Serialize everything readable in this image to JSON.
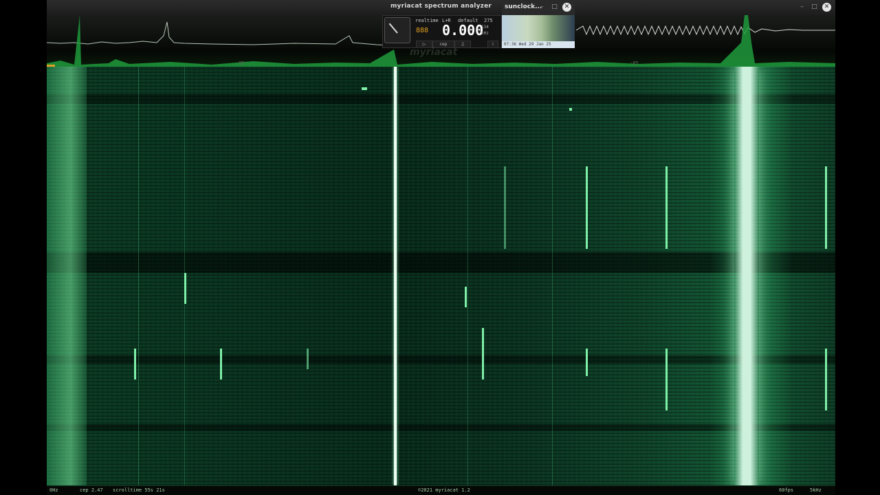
{
  "window": {
    "title": "myriacat spectrum analyzer",
    "controls": {
      "minimize": "–",
      "maximize": "□",
      "close": "✕"
    }
  },
  "spectrum": {
    "db_left": "-85",
    "db_right": "-85"
  },
  "meter": {
    "mode": "realtime",
    "channel": "L+R",
    "profile": "default",
    "value_top": "275",
    "value": "0.000",
    "unit_top": "134",
    "unit": "kHz",
    "digits": "888",
    "btn_ctrl": "▷",
    "btn_mode": "cep",
    "btn_music": "♫",
    "btn_info": "i",
    "brand": "myriacat"
  },
  "sunclock": {
    "title": "sunclock...",
    "time": "07:36 Wed 29 Jan 25",
    "controls": {
      "minimize": "–",
      "maximize": "□",
      "close": "✕"
    }
  },
  "statusbar": {
    "freq_start": "0Hz",
    "cep": "cep 2.47",
    "scrolltime": "scrolltime 55s 21s",
    "copyright": "©2021 myriacat 1.2",
    "fps": "60fps",
    "freq_end": "5kHz"
  },
  "colors": {
    "accent": "#2ee06a",
    "waterfall_base": "#0a3420",
    "hot_signal": "#ffffff"
  }
}
